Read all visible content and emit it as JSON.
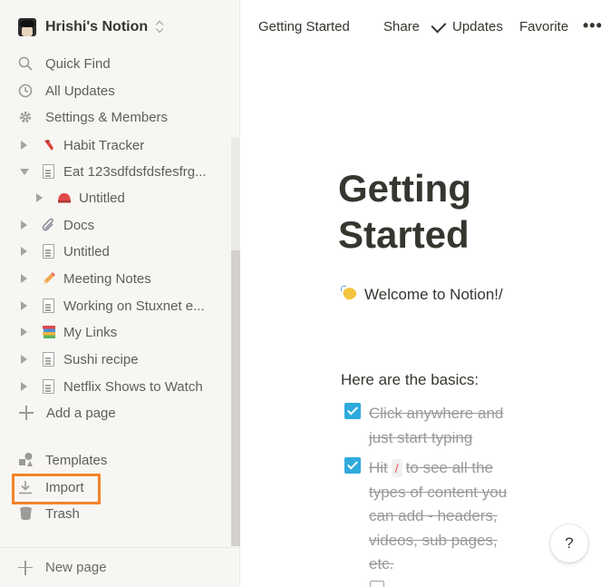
{
  "workspace": {
    "name": "Hrishi's Notion"
  },
  "nav": {
    "quick_find": "Quick Find",
    "all_updates": "All Updates",
    "settings": "Settings & Members"
  },
  "pages": [
    {
      "label": "Habit Tracker",
      "icon": "red-shoe-icon",
      "expanded": false,
      "level": 0
    },
    {
      "label": "Eat 123sdfdsfdsfesfrg...",
      "icon": "document-icon",
      "expanded": true,
      "level": 0
    },
    {
      "label": "Untitled",
      "icon": "red-helmet-icon",
      "expanded": false,
      "level": 1
    },
    {
      "label": "Docs",
      "icon": "paperclip-icon",
      "expanded": false,
      "level": 0
    },
    {
      "label": "Untitled",
      "icon": "document-icon",
      "expanded": false,
      "level": 0
    },
    {
      "label": "Meeting Notes",
      "icon": "pencil-icon",
      "expanded": false,
      "level": 0
    },
    {
      "label": "Working on Stuxnet e...",
      "icon": "document-icon",
      "expanded": false,
      "level": 0
    },
    {
      "label": "My Links",
      "icon": "books-icon",
      "expanded": false,
      "level": 0
    },
    {
      "label": "Sushi recipe",
      "icon": "document-icon",
      "expanded": false,
      "level": 0
    },
    {
      "label": "Netflix Shows to Watch",
      "icon": "document-icon",
      "expanded": false,
      "level": 0
    }
  ],
  "add_page": "Add a page",
  "templates": "Templates",
  "import": "Import",
  "trash": "Trash",
  "new_page": "New page",
  "topbar": {
    "breadcrumb": "Getting Started",
    "share": "Share",
    "updates": "Updates",
    "favorite": "Favorite",
    "more": "•••"
  },
  "content": {
    "title_line1": "Getting",
    "title_line2": "Started",
    "welcome": "Welcome to Notion!/",
    "basics": "Here are the basics:",
    "todo1": "Click anywhere and just start typing",
    "todo2_before": "Hit",
    "todo2_key": "/",
    "todo2_after": "to see all the types of content you can add - headers, videos, sub pages, etc."
  },
  "help": "?",
  "colors": {
    "sidebar_bg": "#f7f6f3",
    "checkbox": "#2eaadc",
    "highlight": "#f2832a"
  }
}
